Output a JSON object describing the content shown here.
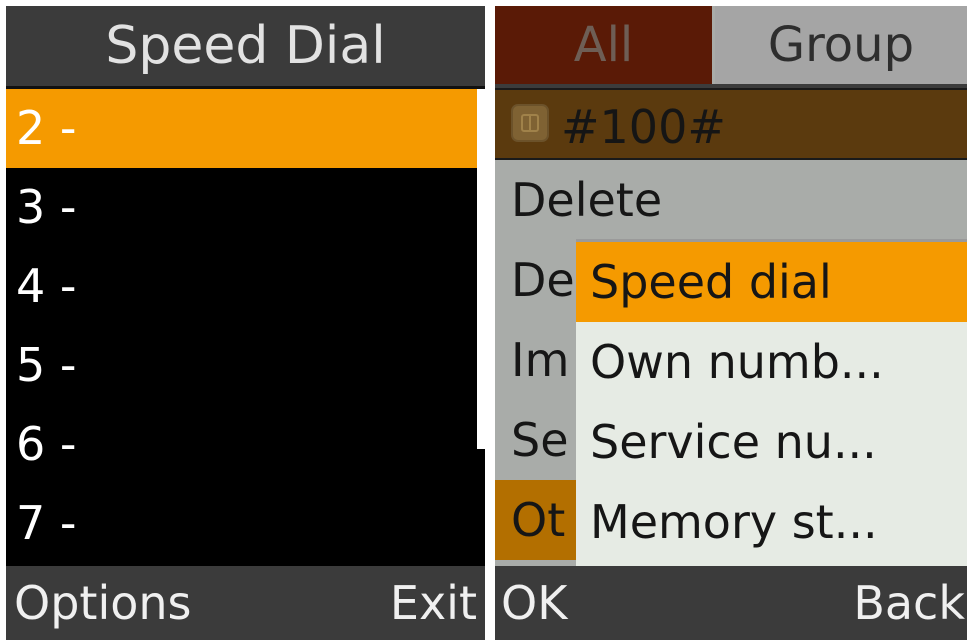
{
  "left_screen": {
    "title": "Speed Dial",
    "entries": [
      {
        "label": "2 -"
      },
      {
        "label": "3 -"
      },
      {
        "label": "4 -"
      },
      {
        "label": "5 -"
      },
      {
        "label": "6 -"
      },
      {
        "label": "7 -"
      }
    ],
    "softkeys": {
      "left": "Options",
      "right": "Exit"
    }
  },
  "right_screen": {
    "tabs": [
      {
        "label": "All"
      },
      {
        "label": "Group"
      }
    ],
    "contact": {
      "icon": "sim-card-icon",
      "number": "#100#"
    },
    "options_menu": [
      {
        "label": "Delete"
      },
      {
        "label": "De"
      },
      {
        "label": "Im"
      },
      {
        "label": "Se"
      },
      {
        "label": "Ot"
      }
    ],
    "submenu": [
      {
        "label": "Speed dial"
      },
      {
        "label": "Own numb..."
      },
      {
        "label": "Service nu..."
      },
      {
        "label": "Memory st..."
      }
    ],
    "softkeys": {
      "left": "OK",
      "right": "Back"
    }
  },
  "colors": {
    "highlight": "#f59a00",
    "dim_highlight": "#b36f00",
    "bar": "#3b3b3b"
  }
}
